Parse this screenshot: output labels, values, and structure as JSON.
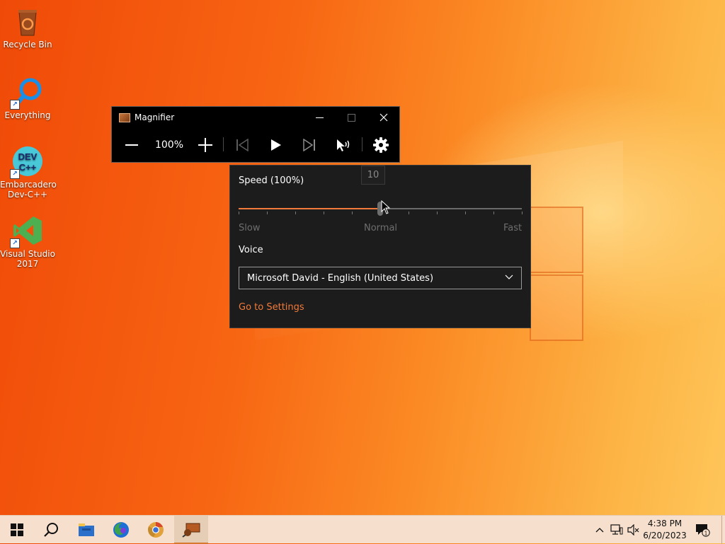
{
  "desktop": {
    "icons": [
      {
        "label_line1": "Recycle Bin",
        "label_line2": "",
        "icon": "recycle-bin-icon"
      },
      {
        "label_line1": "Everything",
        "label_line2": "",
        "icon": "everything-search-icon"
      },
      {
        "label_line1": "Embarcadero",
        "label_line2": "Dev-C++",
        "icon": "dev-cpp-icon",
        "icon_text_top": "DEV",
        "icon_text_bottom": "C++"
      },
      {
        "label_line1": "Visual Studio",
        "label_line2": "2017",
        "icon": "visual-studio-icon"
      }
    ]
  },
  "magnifier": {
    "title": "Magnifier",
    "zoom_level": "100%",
    "buttons": {
      "zoom_out": "minus-icon",
      "zoom_in": "plus-icon",
      "previous": "previous-icon",
      "play": "play-icon",
      "next": "next-icon",
      "read_from_here": "read-from-here-icon",
      "settings": "gear-icon"
    }
  },
  "reading_settings": {
    "speed_label": "Speed (100%)",
    "speed_value": 10,
    "speed_tooltip": "10",
    "speed_min_label": "Slow",
    "speed_mid_label": "Normal",
    "speed_max_label": "Fast",
    "voice_label": "Voice",
    "voice_selected": "Microsoft David - English (United States)",
    "settings_link": "Go to Settings"
  },
  "taskbar": {
    "apps": [
      "start-icon",
      "search-icon",
      "file-explorer-icon",
      "firefox-icon",
      "chrome-icon",
      "magnifier-icon"
    ],
    "active_app": "magnifier-icon",
    "clock_time": "4:38 PM",
    "clock_date": "6/20/2023",
    "notification_count": "1"
  },
  "colors": {
    "accent": "#f27a3a",
    "flyout_bg": "#1c1c1c",
    "toolbar_bg": "#000000",
    "taskbar_bg": "#f6e0cd"
  }
}
